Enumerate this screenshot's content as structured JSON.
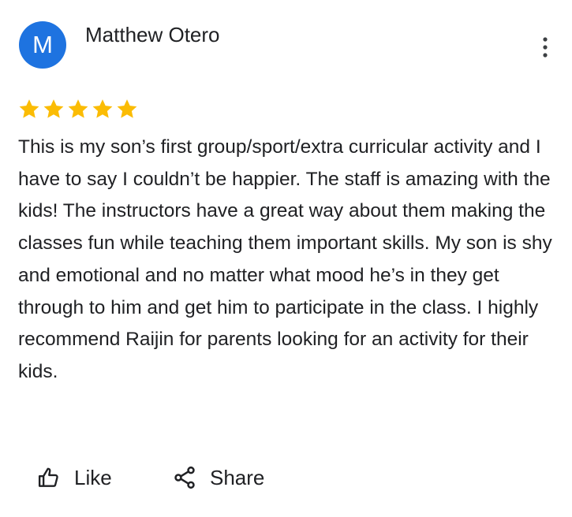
{
  "review": {
    "author": {
      "initial": "M",
      "name": "Matthew Otero",
      "avatar_color": "#1e73e0"
    },
    "menu_icon": "more-vert-icon",
    "rating": {
      "stars": 5,
      "max": 5,
      "star_color": "#fbbc04"
    },
    "text": "This is my son’s first group/sport/extra curricular activity and I have to say I couldn’t be happier. The staff is amazing with the kids! The instructors have a great way about them making the classes fun while teaching them important skills. My son is shy and emotional and no matter what mood he’s in they get through to him and get him to participate in the class. I highly recommend Raijin for parents looking for an activity for their kids."
  },
  "actions": {
    "like_label": "Like",
    "like_icon": "thumb-up-icon",
    "share_label": "Share",
    "share_icon": "share-icon"
  }
}
